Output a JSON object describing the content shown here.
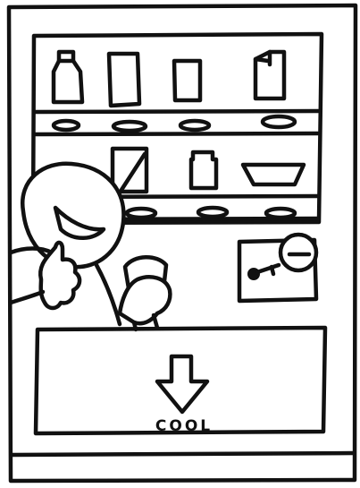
{
  "dispenser": {
    "label": "COOL"
  },
  "colors": {
    "ink": "#111111",
    "paper": "#ffffff"
  },
  "icons": {
    "dispense": "arrow-down-icon",
    "coin_slot": "coin-slot-icon",
    "key": "key-icon"
  }
}
